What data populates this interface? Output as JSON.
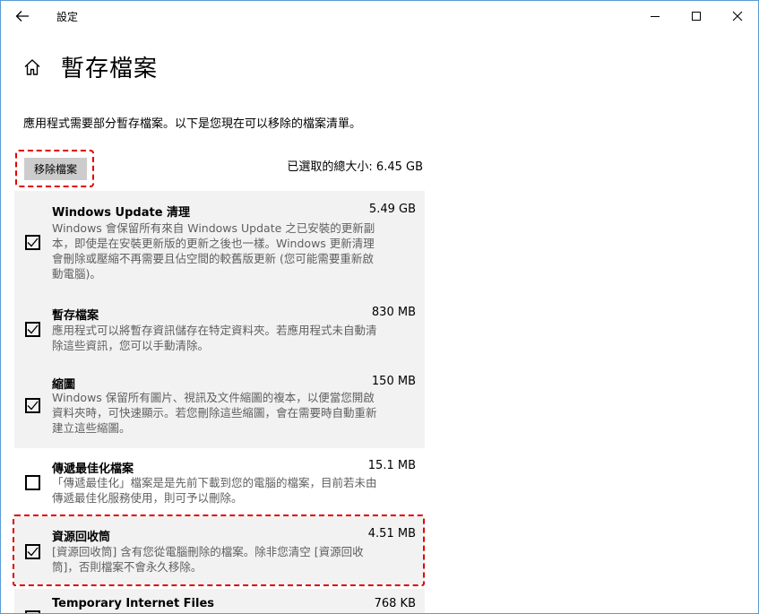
{
  "window": {
    "app_title": "設定",
    "controls": {
      "minimize": "minimize-icon",
      "maximize": "maximize-icon",
      "close": "close-icon"
    }
  },
  "page": {
    "title": "暫存檔案",
    "description": "應用程式需要部分暫存檔案。以下是您現在可以移除的檔案清單。",
    "remove_button": "移除檔案",
    "total_selected": "已選取的總大小: 6.45 GB"
  },
  "items": [
    {
      "name": "Windows Update 清理",
      "size": "5.49 GB",
      "checked": true,
      "desc": [
        "Windows 會保留所有來自 Windows Update 之已安裝的更新副",
        "本，即使是在安裝更新版的更新之後也一樣。Windows 更新清理",
        "會刪除或壓縮不再需要且佔空間的較舊版更新 (您可能需要重新啟",
        "動電腦)。"
      ]
    },
    {
      "name": "暫存檔案",
      "size": "830 MB",
      "checked": true,
      "desc": [
        "應用程式可以將暫存資訊儲存在特定資料夾。若應用程式未自動清",
        "除這些資訊，您可以手動清除。"
      ]
    },
    {
      "name": "縮圖",
      "size": "150 MB",
      "checked": true,
      "desc": [
        "Windows 保留所有圖片、視訊及文件縮圖的複本，以便當您開啟",
        "資料夾時，可快速顯示。若您刪除這些縮圖，會在需要時自動重新",
        "建立這些縮圖。"
      ]
    },
    {
      "name": "傳遞最佳化檔案",
      "size": "15.1 MB",
      "checked": false,
      "desc": [
        "「傳遞最佳化」檔案是是先前下載到您的電腦的檔案，目前若未由",
        "傳遞最佳化服務使用，則可予以刪除。"
      ]
    },
    {
      "name": "資源回收筒",
      "size": "4.51 MB",
      "checked": true,
      "desc": [
        "[資源回收筒] 含有您從電腦刪除的檔案。除非您清空 [資源回收",
        "筒]，否則檔案不會永久移除。"
      ]
    },
    {
      "name": "Temporary Internet Files",
      "size": "768 KB",
      "checked": true,
      "desc": []
    }
  ]
}
